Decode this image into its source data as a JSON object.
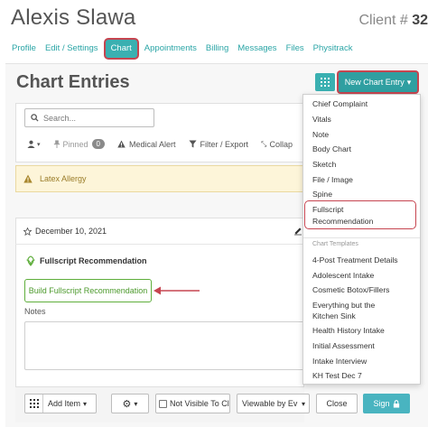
{
  "header": {
    "client_name": "Alexis Slawa",
    "client_label": "Client # ",
    "client_number": "32"
  },
  "tabs": [
    {
      "label": "Profile"
    },
    {
      "label": "Edit / Settings"
    },
    {
      "label": "Chart",
      "active": true
    },
    {
      "label": "Appointments"
    },
    {
      "label": "Billing"
    },
    {
      "label": "Messages"
    },
    {
      "label": "Files"
    },
    {
      "label": "Physitrack"
    }
  ],
  "page": {
    "title": "Chart Entries",
    "new_entry_label": "New Chart Entry",
    "search_placeholder": "Search..."
  },
  "filters": {
    "pinned_label": "Pinned",
    "pinned_count": "0",
    "medical_alert_label": "Medical Alert",
    "filter_export_label": "Filter / Export",
    "collapse_label": "Collap"
  },
  "alert": {
    "text": "Latex Allergy"
  },
  "entry": {
    "date": "December 10, 2021",
    "fullscript_title": "Fullscript Recommendation",
    "build_button_label": "Build Fullscript Recommendation",
    "notes_label": "Notes"
  },
  "footer": {
    "add_item_label": "Add Item",
    "not_visible_label": "Not Visible To Cli",
    "viewable_label": "Viewable by Ev",
    "close_label": "Close",
    "sign_label": "Sign"
  },
  "dropdown": {
    "items": [
      "Chief Complaint",
      "Vitals",
      "Note",
      "Body Chart",
      "Sketch",
      "File / Image",
      "Spine"
    ],
    "highlighted": {
      "line1": "Fullscript",
      "line2": "Recommendation"
    },
    "templates_header": "Chart Templates",
    "templates": [
      "4-Post Treatment Details",
      "Adolescent Intake",
      "Cosmetic Botox/Fillers"
    ],
    "everything_line1": "Everything but the",
    "everything_line2": "Kitchen Sink",
    "templates_after": [
      "Health History Intake",
      "Initial Assessment",
      "Intake Interview",
      "KH Test Dec 7"
    ]
  },
  "colors": {
    "accent": "#3ab0b1",
    "annotation": "#c64550",
    "fullscript_green": "#5fae3c",
    "sign_button": "#49b4c0"
  }
}
